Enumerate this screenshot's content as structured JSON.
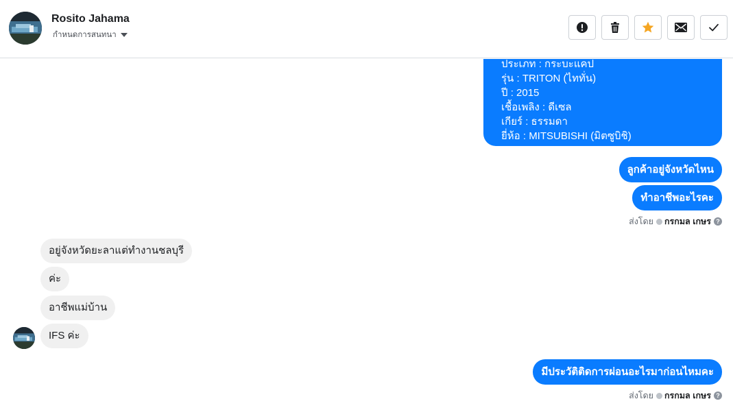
{
  "header": {
    "contact_name": "Rosito Jahama",
    "conversation_label": "กำหนดการสนทนา",
    "toolbar": [
      {
        "name": "spam-button",
        "icon": "exclamation-circle-icon"
      },
      {
        "name": "delete-button",
        "icon": "trash-icon"
      },
      {
        "name": "star-button",
        "icon": "star-icon",
        "color": "#f5a623"
      },
      {
        "name": "mark-unread-button",
        "icon": "envelope-icon"
      },
      {
        "name": "done-button",
        "icon": "check-icon"
      }
    ]
  },
  "thread": {
    "vehicle_info_lines": [
      "ประเภท : กระบะแคป",
      "รุ่น : TRITON (ไททั่น)",
      "ปี : 2015",
      "เชื้อเพลิง : ดีเซล",
      "เกียร์ : ธรรมดา",
      "ยี่ห้อ : MITSUBISHI (มิตซูบิชิ)"
    ],
    "outgoing_group_1": [
      "ลูกค้าอยู่จังหวัดไหน",
      "ทำอาชีพอะไรคะ"
    ],
    "sent_by_1": {
      "prefix": "ส่งโดย",
      "name": "กรกมล เกษร"
    },
    "incoming": [
      "อยู่จังหวัดยะลาแต่ทำงานชลบุรี",
      "ค่ะ",
      "อาชีพแม่บ้าน",
      "IFS ค่ะ"
    ],
    "outgoing_group_2": [
      "มีประวัติติดการผ่อนอะไรมาก่อนไหมคะ"
    ],
    "sent_by_2": {
      "prefix": "ส่งโดย",
      "name": "กรกมล เกษร"
    }
  },
  "colors": {
    "outgoing_bubble": "#0a7cff",
    "incoming_bubble": "#f0f0f0",
    "star": "#f5a623"
  }
}
